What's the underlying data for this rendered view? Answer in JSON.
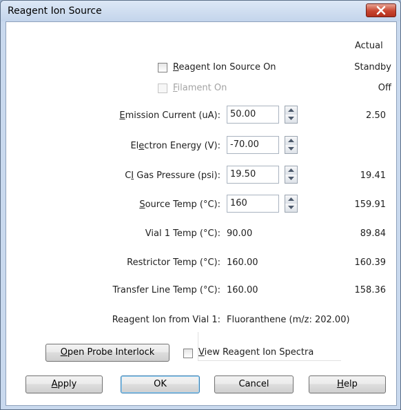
{
  "window": {
    "title": "Reagent Ion Source"
  },
  "header": {
    "actual_label": "Actual"
  },
  "checks": {
    "source_on": {
      "hotkey": "R",
      "rest": "eagent Ion Source On",
      "checked": false
    },
    "filament_on": {
      "hotkey": "F",
      "rest": "ilament On",
      "checked": false,
      "enabled": false
    }
  },
  "status": {
    "source": "Standby",
    "filament": "Off"
  },
  "fields": [
    {
      "hotkey": "E",
      "rest": "mission Current (uA):",
      "value": "50.00",
      "actual": "2.50"
    },
    {
      "pre": "El",
      "hotkey": "e",
      "rest": "ctron Energy (V):",
      "value": "-70.00",
      "actual": ""
    },
    {
      "pre": "C",
      "hotkey": "I",
      "rest": " Gas Pressure (psi):",
      "value": "19.50",
      "actual": "19.41"
    },
    {
      "hotkey": "S",
      "rest": "ource Temp (°C):",
      "value": "160",
      "actual": "159.91"
    }
  ],
  "readonly": [
    {
      "label": "Vial 1 Temp (°C):",
      "value": "90.00",
      "actual": "89.84"
    },
    {
      "label": "Restrictor Temp (°C):",
      "value": "160.00",
      "actual": "160.39"
    },
    {
      "label": "Transfer Line Temp (°C):",
      "value": "160.00",
      "actual": "158.36"
    },
    {
      "label": "Reagent Ion from Vial 1:",
      "value": "Fluoranthene (m/z: 202.00)",
      "actual": ""
    }
  ],
  "probe": {
    "hotkey": "O",
    "rest": "pen Probe Interlock"
  },
  "spectra": {
    "hotkey": "V",
    "rest": "iew Reagent Ion Spectra",
    "checked": false
  },
  "buttons": {
    "apply": {
      "hotkey": "A",
      "rest": "pply"
    },
    "ok": {
      "label": "OK"
    },
    "cancel": {
      "label": "Cancel"
    },
    "help": {
      "hotkey": "H",
      "rest": "elp"
    }
  },
  "colors": {
    "titlebar": "#c3d4eb",
    "close": "#c8452f",
    "client": "#ffffff",
    "default_button_border": "#3c7fb1"
  },
  "icons": {
    "close": "close-icon",
    "spin_up": "spin-up-arrow-icon",
    "spin_down": "spin-down-arrow-icon"
  }
}
